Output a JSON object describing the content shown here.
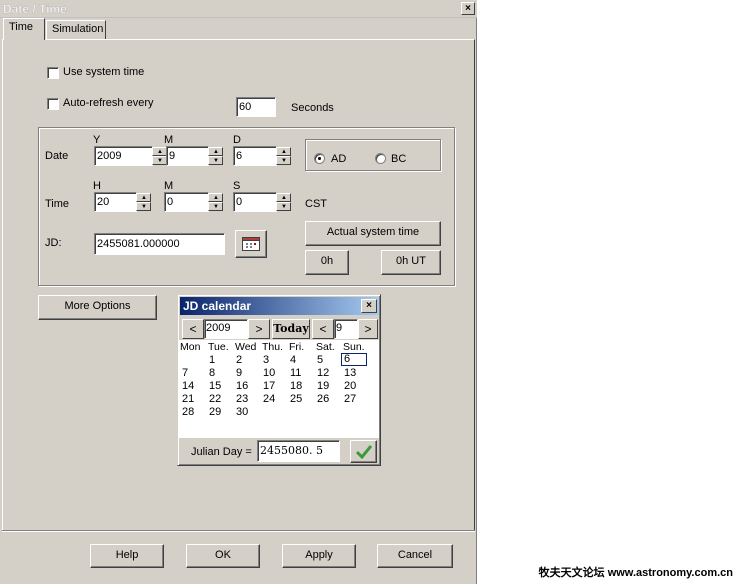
{
  "window": {
    "title": "Date / Time",
    "close_glyph": "×"
  },
  "tabs": [
    {
      "label": "Time",
      "active": true
    },
    {
      "label": "Simulation",
      "active": false
    }
  ],
  "options": {
    "use_system_time": {
      "label": "Use system time",
      "checked": false
    },
    "auto_refresh": {
      "label": "Auto-refresh every",
      "checked": false,
      "value": "60",
      "unit": "Seconds"
    }
  },
  "date": {
    "label": "Date",
    "y_label": "Y",
    "m_label": "M",
    "d_label": "D",
    "year": "2009",
    "month": "9",
    "day": "6",
    "era_ad": "AD",
    "era_bc": "BC",
    "era_selected": "AD"
  },
  "time": {
    "label": "Time",
    "h_label": "H",
    "m_label": "M",
    "s_label": "S",
    "hour": "20",
    "minute": "0",
    "second": "0",
    "zone": "CST"
  },
  "jd": {
    "label": "JD:",
    "value": "2455081.000000",
    "calendar_icon": "calendar-icon"
  },
  "buttons": {
    "actual_system_time": "Actual system time",
    "zero_h": "0h",
    "zero_h_ut": "0h UT",
    "more_options": "More Options",
    "help": "Help",
    "ok": "OK",
    "apply": "Apply",
    "cancel": "Cancel"
  },
  "calendar": {
    "title": "JD calendar",
    "close_glyph": "×",
    "prev_glyph": "<",
    "next_glyph": ">",
    "year": "2009",
    "today_label": "Today",
    "month": "9",
    "weekdays": [
      "Mon",
      "Tue.",
      "Wed",
      "Thu.",
      "Fri.",
      "Sat.",
      "Sun."
    ],
    "weeks": [
      [
        "",
        "1",
        "2",
        "3",
        "4",
        "5",
        "6"
      ],
      [
        "7",
        "8",
        "9",
        "10",
        "11",
        "12",
        "13"
      ],
      [
        "14",
        "15",
        "16",
        "17",
        "18",
        "19",
        "20"
      ],
      [
        "21",
        "22",
        "23",
        "24",
        "25",
        "26",
        "27"
      ],
      [
        "28",
        "29",
        "30",
        "",
        "",
        "",
        ""
      ]
    ],
    "selected_day": "6",
    "julian_day_label": "Julian Day =",
    "julian_day_value": "2455080. 5",
    "confirm_icon": "checkmark-icon"
  },
  "watermark": "牧夫天文论坛 www.astronomy.com.cn",
  "colors": {
    "face": "#d4d0c8",
    "active_title": "#0a246a",
    "confirm": "#3c9a3c"
  }
}
